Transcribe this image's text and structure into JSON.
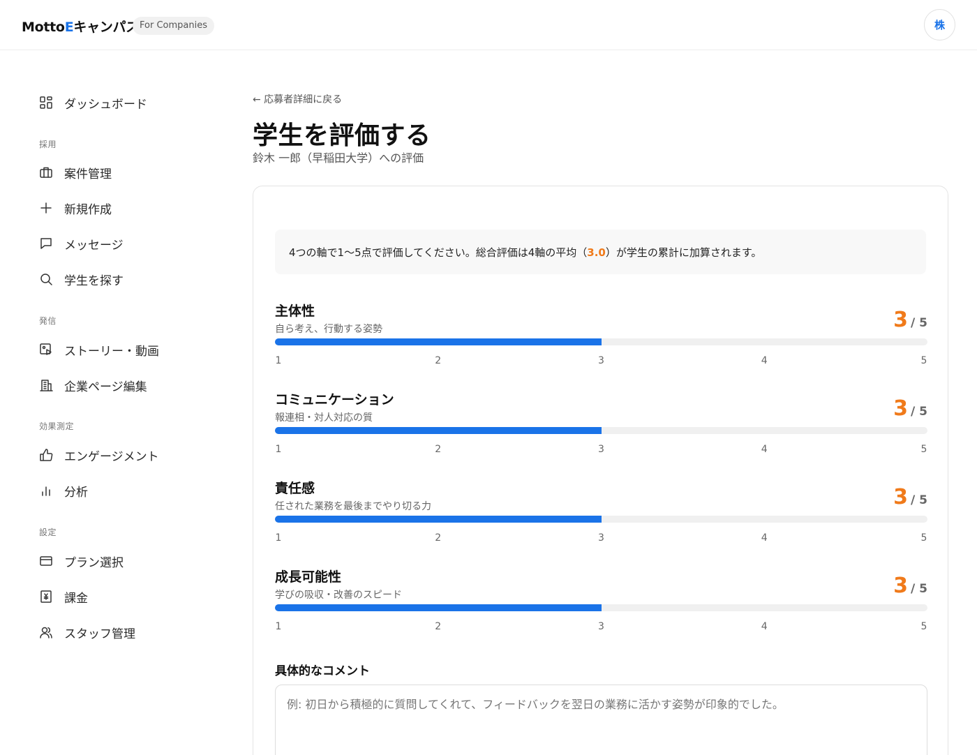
{
  "header": {
    "logo_prefix": "Motto",
    "logo_e": "E",
    "logo_suffix": "キャンパス",
    "badge": "For Companies",
    "avatar_initial": "株"
  },
  "sidebar": {
    "dashboard": "ダッシュボード",
    "sections": {
      "recruit": "採用",
      "publish": "発信",
      "measure": "効果測定",
      "settings": "設定"
    },
    "items": {
      "jobs": "案件管理",
      "new": "新規作成",
      "messages": "メッセージ",
      "search": "学生を探す",
      "stories": "ストーリー・動画",
      "company_page": "企業ページ編集",
      "engagement": "エンゲージメント",
      "analytics": "分析",
      "plan": "プラン選択",
      "billing": "課金",
      "staff": "スタッフ管理"
    }
  },
  "main": {
    "back_link": "← 応募者詳細に戻る",
    "title": "学生を評価する",
    "subtitle": "鈴木 一郎（早稲田大学）への評価",
    "info_before": "4つの軸で1〜5点で評価してください。総合評価は4軸の平均（",
    "info_avg": "3.0",
    "info_after": "）が学生の累計に加算されます。",
    "axes": [
      {
        "title": "主体性",
        "desc": "自ら考え、行動する姿勢",
        "score": "3",
        "of": "/ 5",
        "value": 3
      },
      {
        "title": "コミュニケーション",
        "desc": "報連相・対人対応の質",
        "score": "3",
        "of": "/ 5",
        "value": 3
      },
      {
        "title": "責任感",
        "desc": "任された業務を最後までやり切る力",
        "score": "3",
        "of": "/ 5",
        "value": 3
      },
      {
        "title": "成長可能性",
        "desc": "学びの吸収・改善のスピード",
        "score": "3",
        "of": "/ 5",
        "value": 3
      }
    ],
    "ticks": [
      "1",
      "2",
      "3",
      "4",
      "5"
    ],
    "comment_label": "具体的なコメント",
    "comment_placeholder": "例: 初日から積極的に質問してくれて、フィードバックを翌日の業務に活かす姿勢が印象的でした。"
  },
  "colors": {
    "accent": "#1a73e8",
    "score": "#f07a1a"
  }
}
